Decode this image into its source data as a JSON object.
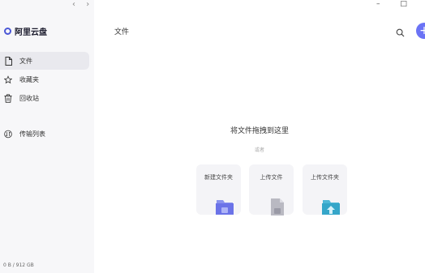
{
  "app": {
    "name": "阿里云盘"
  },
  "window_controls": {
    "minimize": "–",
    "close": "□"
  },
  "nav_arrows": {
    "back": "‹",
    "forward": "›"
  },
  "sidebar": {
    "items": [
      {
        "label": "文件",
        "icon": "file-icon",
        "active": true
      },
      {
        "label": "收藏夹",
        "icon": "star-icon",
        "active": false
      },
      {
        "label": "回收站",
        "icon": "trash-icon",
        "active": false
      },
      {
        "label": "传输列表",
        "icon": "transfer-icon",
        "active": false
      }
    ],
    "storage": "0 B / 912 GB"
  },
  "header": {
    "title": "文件",
    "add_label": "+"
  },
  "empty_state": {
    "title": "将文件拖拽到这里",
    "or_text": "或者",
    "actions": [
      {
        "label": "新建文件夹",
        "icon": "new-folder-icon"
      },
      {
        "label": "上传文件",
        "icon": "upload-file-icon"
      },
      {
        "label": "上传文件夹",
        "icon": "upload-folder-icon"
      }
    ]
  },
  "colors": {
    "accent": "#6b73f5",
    "sidebar_bg": "#f7f7f9",
    "active_item_bg": "#e9e9ee"
  }
}
